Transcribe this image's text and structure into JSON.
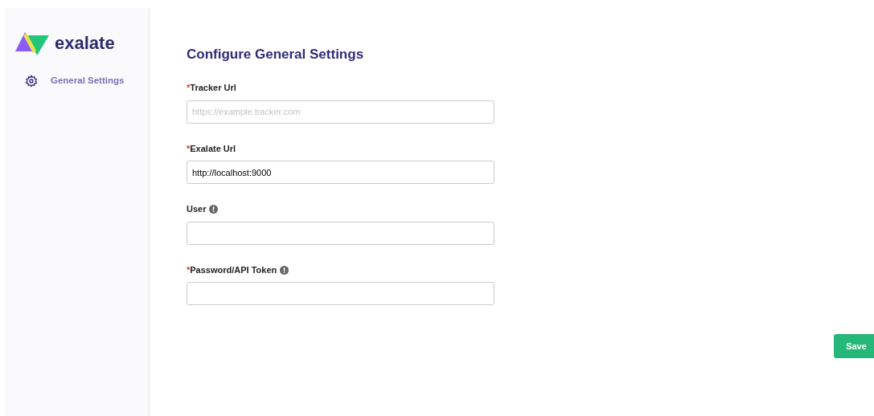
{
  "sidebar": {
    "logo_text": "exalate",
    "items": [
      {
        "label": "General Settings",
        "selected": true
      }
    ]
  },
  "form": {
    "title": "Configure General Settings",
    "fields": [
      {
        "required_mark": "*",
        "label": "Tracker Url",
        "info": false,
        "placeholder": "https://example.tracker.com"
      },
      {
        "required_mark": "*",
        "label": "Exalate Url",
        "info": false,
        "value": "http://localhost:9000"
      },
      {
        "label": "User",
        "info": true
      },
      {
        "required_mark": "*",
        "label": "Password/API Token",
        "info": true
      }
    ]
  },
  "save_button": "Save"
}
